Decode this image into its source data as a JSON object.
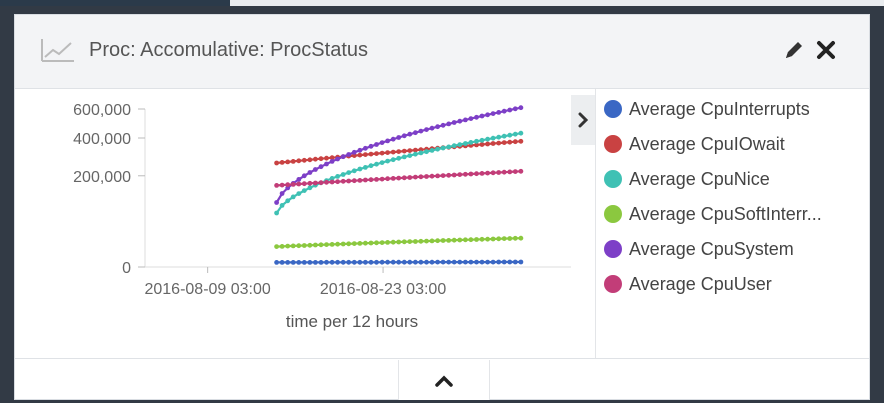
{
  "panel": {
    "title": "Proc: Accomulative: ProcStatus",
    "title_icon": "line-chart-icon",
    "edit_icon": "pencil-icon",
    "close_icon": "close-icon",
    "collapse_legend_icon": "chevron-right-icon",
    "expand_icon": "chevron-up-icon"
  },
  "legend": {
    "items": [
      {
        "label": "Average CpuInterrupts",
        "color": "#3a67c4"
      },
      {
        "label": "Average CpuIOwait",
        "color": "#c94242"
      },
      {
        "label": "Average CpuNice",
        "color": "#3fc1b4"
      },
      {
        "label": "Average CpuSoftInterr...",
        "color": "#8bc83f"
      },
      {
        "label": "Average CpuSystem",
        "color": "#7d3fc7"
      },
      {
        "label": "Average CpuUser",
        "color": "#c23d78"
      }
    ]
  },
  "chart_data": {
    "type": "line",
    "xlabel": "time per 12 hours",
    "ylabel": "",
    "x_ticks": [
      "2016-08-09 03:00",
      "2016-08-23 03:00"
    ],
    "y_ticks": [
      "0",
      "200,000",
      "400,000",
      "600,000"
    ],
    "y_scale": "sqrt",
    "ylim": [
      0,
      600000
    ],
    "x_range_days": [
      0,
      34
    ],
    "x_tick_days": [
      5,
      19
    ],
    "series_x_days": [
      10.5,
      30
    ],
    "series": [
      {
        "name": "Average CpuInterrupts",
        "color": "#3a67c4",
        "values": [
          500,
          600
        ]
      },
      {
        "name": "Average CpuIOwait",
        "color": "#c94242",
        "values": [
          260000,
          380000
        ]
      },
      {
        "name": "Average CpuNice",
        "color": "#3fc1b4",
        "values": [
          70000,
          430000
        ]
      },
      {
        "name": "Average CpuSoftInterr...",
        "color": "#8bc83f",
        "values": [
          10000,
          20000
        ]
      },
      {
        "name": "Average CpuSystem",
        "color": "#7d3fc7",
        "values": [
          100000,
          610000
        ]
      },
      {
        "name": "Average CpuUser",
        "color": "#c23d78",
        "values": [
          160000,
          220000
        ]
      }
    ]
  }
}
